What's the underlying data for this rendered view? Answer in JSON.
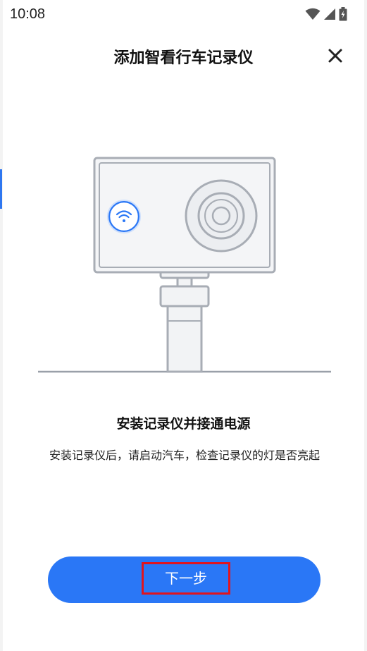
{
  "status_bar": {
    "time": "10:08",
    "icons": [
      "wifi-icon",
      "cell-signal-icon",
      "battery-charging-icon"
    ]
  },
  "header": {
    "title": "添加智看行车记录仪",
    "close_icon": "close-icon"
  },
  "illustration": {
    "description_icons": [
      "dashcam-body",
      "wifi-icon",
      "camera-lens",
      "mount-stand"
    ],
    "accent_color": "#2a77f6"
  },
  "content": {
    "heading": "安装记录仪并接通电源",
    "description": "安装记录仪后，请启动汽车，检查记录仪的灯是否亮起"
  },
  "button": {
    "next_label": "下一步",
    "color": "#2a77f6",
    "highlight_color": "#e0141e"
  }
}
